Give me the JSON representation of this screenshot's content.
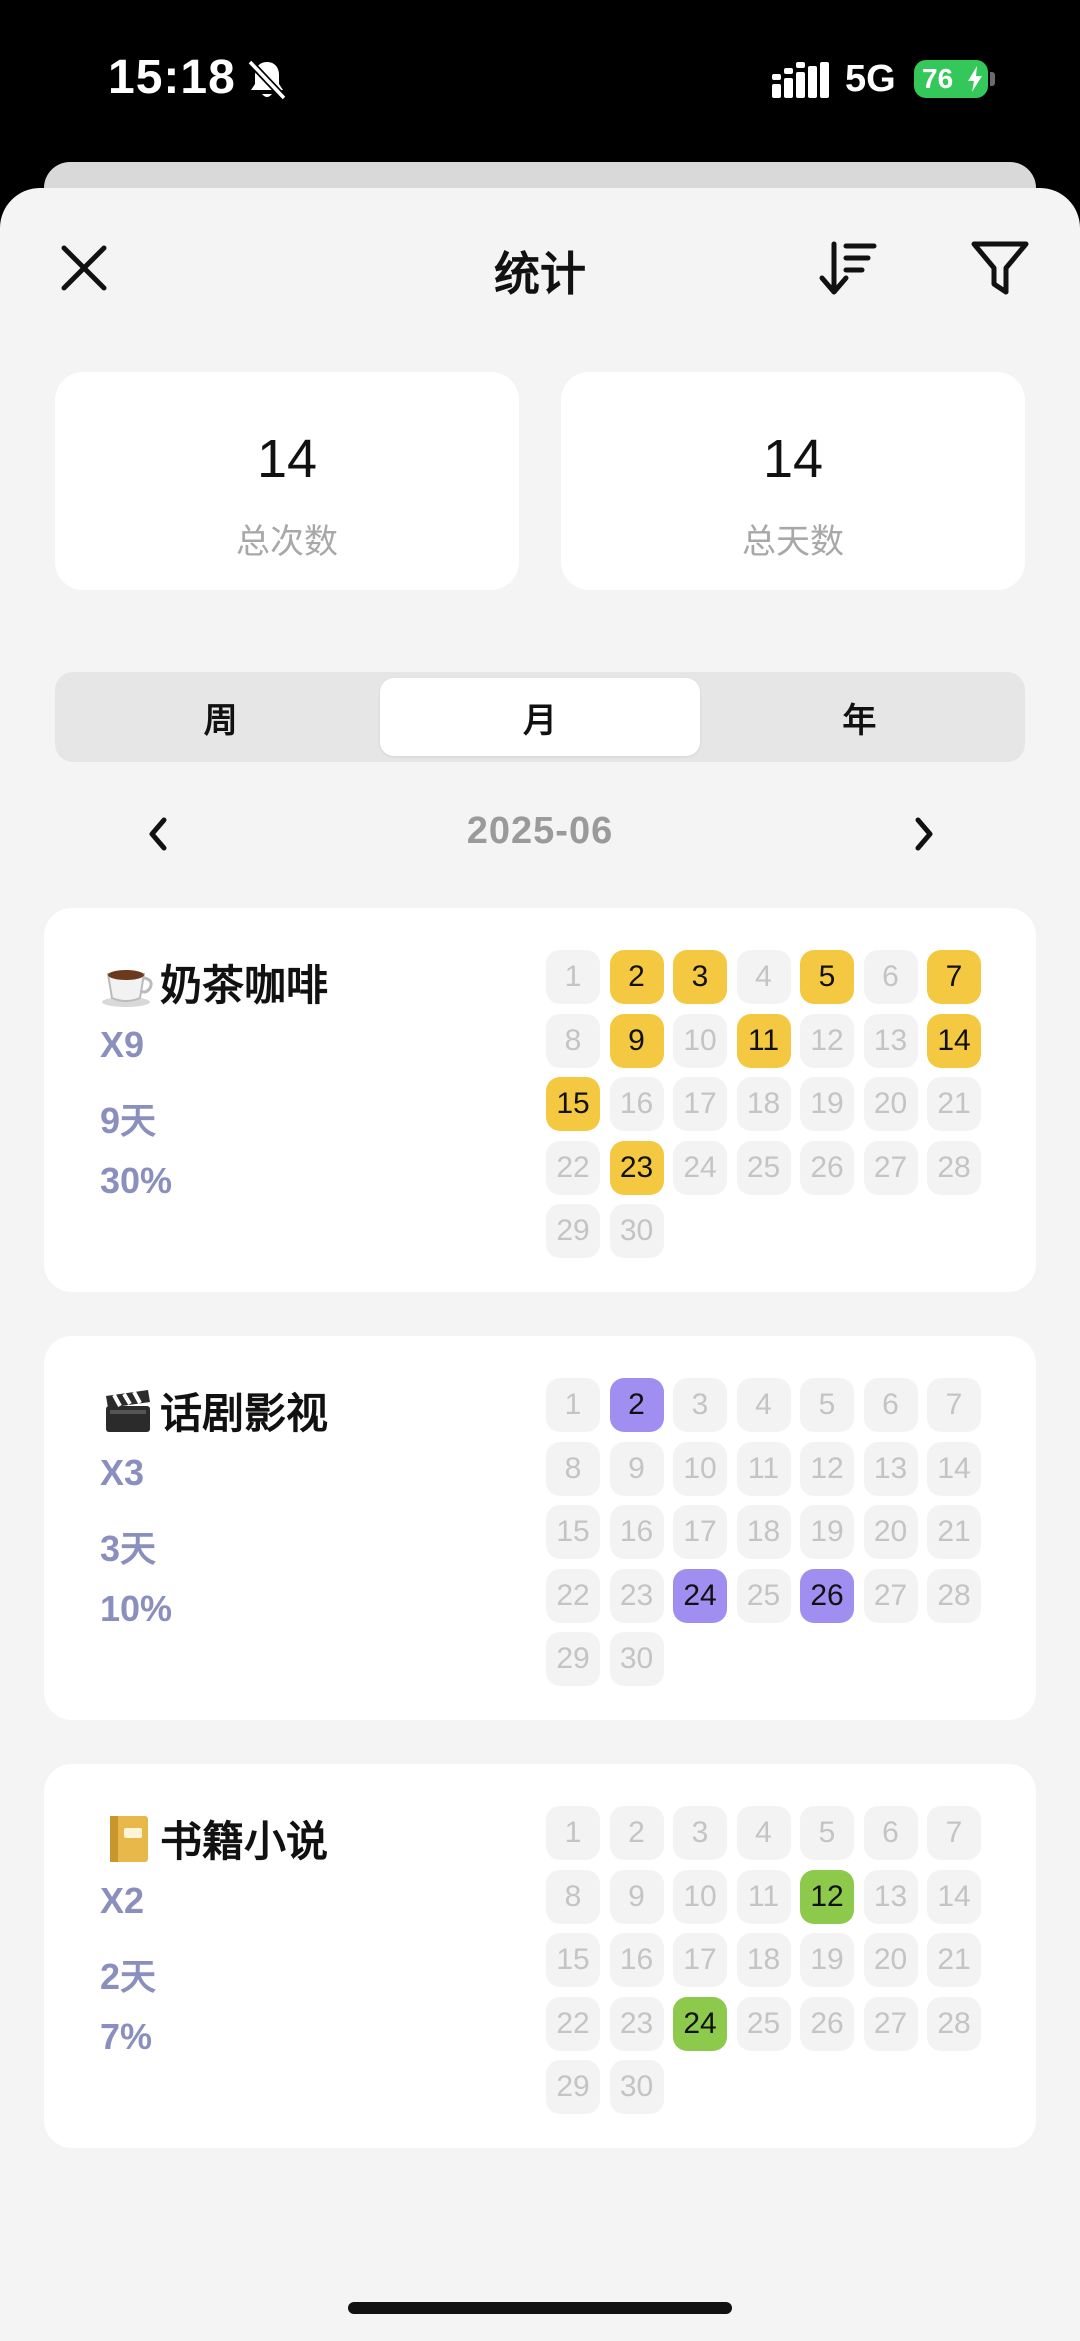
{
  "status_bar": {
    "time": "15:18",
    "network": "5G",
    "battery": "76"
  },
  "header": {
    "title": "统计"
  },
  "summary": [
    {
      "value": "14",
      "label": "总次数"
    },
    {
      "value": "14",
      "label": "总天数"
    }
  ],
  "tabs": [
    {
      "label": "周",
      "active": false
    },
    {
      "label": "月",
      "active": true
    },
    {
      "label": "年",
      "active": false
    }
  ],
  "period": {
    "label": "2025-06"
  },
  "categories": [
    {
      "id": "milk-tea",
      "emoji": "coffee-cup-icon",
      "name": "奶茶咖啡",
      "count": "X9",
      "days": "9天",
      "percent": "30%",
      "color": "#f5c842",
      "active_days": [
        2,
        3,
        5,
        7,
        9,
        11,
        14,
        15,
        23
      ]
    },
    {
      "id": "drama-film",
      "emoji": "clapperboard-icon",
      "name": "话剧影视",
      "count": "X3",
      "days": "3天",
      "percent": "10%",
      "color": "#a08ef0",
      "active_days": [
        2,
        24,
        26
      ]
    },
    {
      "id": "books-novels",
      "emoji": "notebook-icon",
      "name": "书籍小说",
      "count": "X2",
      "days": "2天",
      "percent": "7%",
      "color": "#8dc94a",
      "active_days": [
        12,
        24
      ]
    }
  ],
  "days_in_month": 30
}
